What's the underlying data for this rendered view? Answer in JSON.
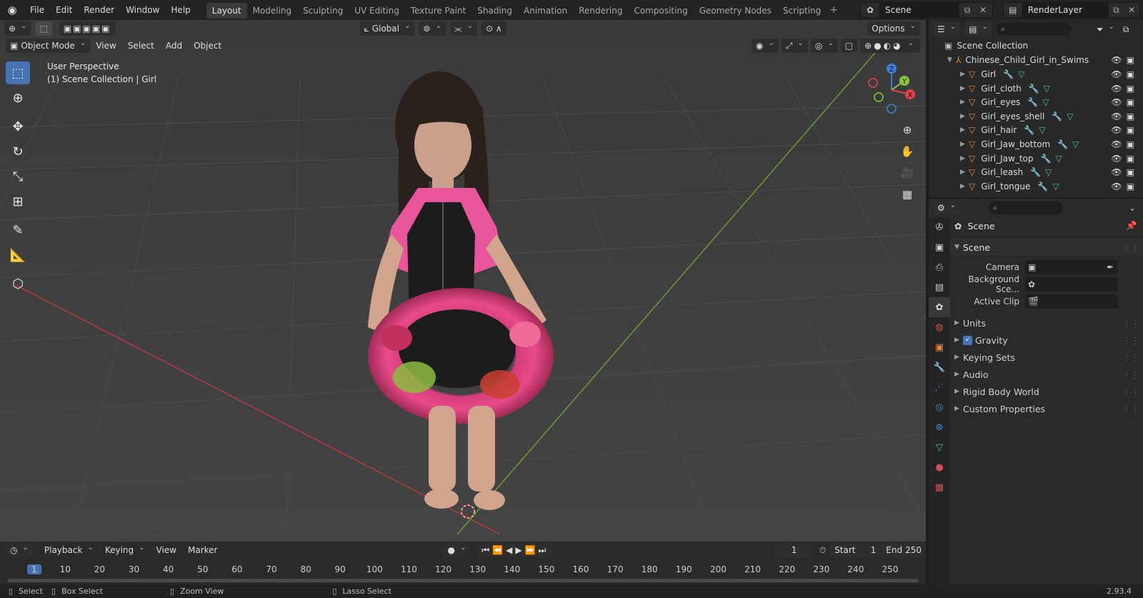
{
  "menu": [
    "File",
    "Edit",
    "Render",
    "Window",
    "Help"
  ],
  "workspaces": [
    "Layout",
    "Modeling",
    "Sculpting",
    "UV Editing",
    "Texture Paint",
    "Shading",
    "Animation",
    "Rendering",
    "Compositing",
    "Geometry Nodes",
    "Scripting"
  ],
  "workspace_add": "+",
  "scene_name": "Scene",
  "view_layer": "RenderLayer",
  "viewport": {
    "mode": "Object Mode",
    "menus": [
      "View",
      "Select",
      "Add",
      "Object"
    ],
    "orientation": "Global",
    "options": "Options",
    "info_line1": "User Perspective",
    "info_line2": "(1) Scene Collection | Girl",
    "gizmo_axes": {
      "x": "X",
      "y": "Y",
      "z": "Z"
    }
  },
  "timeline": {
    "menus": [
      "Playback",
      "Keying",
      "View",
      "Marker"
    ],
    "current_frame": "1",
    "start_label": "Start",
    "start": "1",
    "end_label": "End",
    "end": "250",
    "ruler": [
      "1",
      "10",
      "20",
      "30",
      "40",
      "50",
      "60",
      "70",
      "80",
      "90",
      "100",
      "110",
      "120",
      "130",
      "140",
      "150",
      "160",
      "170",
      "180",
      "190",
      "200",
      "210",
      "220",
      "230",
      "240",
      "250"
    ]
  },
  "statusbar": {
    "select": "Select",
    "box_select": "Box Select",
    "zoom_view": "Zoom View",
    "lasso_select": "Lasso Select",
    "version": "2.93.4"
  },
  "outliner": {
    "root": "Scene Collection",
    "collection": "Chinese_Child_Girl_in_Swims",
    "items": [
      "Girl",
      "Girl_cloth",
      "Girl_eyes",
      "Girl_eyes_shell",
      "Girl_hair",
      "Girl_Jaw_bottom",
      "Girl_Jaw_top",
      "Girl_leash",
      "Girl_tongue"
    ]
  },
  "properties": {
    "context": "Scene",
    "section": "Scene",
    "fields": [
      {
        "label": "Camera"
      },
      {
        "label": "Background Sce..."
      },
      {
        "label": "Active Clip"
      }
    ],
    "subsections": [
      "Units",
      "Gravity",
      "Keying Sets",
      "Audio",
      "Rigid Body World",
      "Custom Properties"
    ]
  },
  "colors": {
    "accent": "#4772b3",
    "x_axis": "#e0434f",
    "y_axis": "#8bc53f",
    "z_axis": "#3f7fd6",
    "orange": "#e8893a"
  }
}
